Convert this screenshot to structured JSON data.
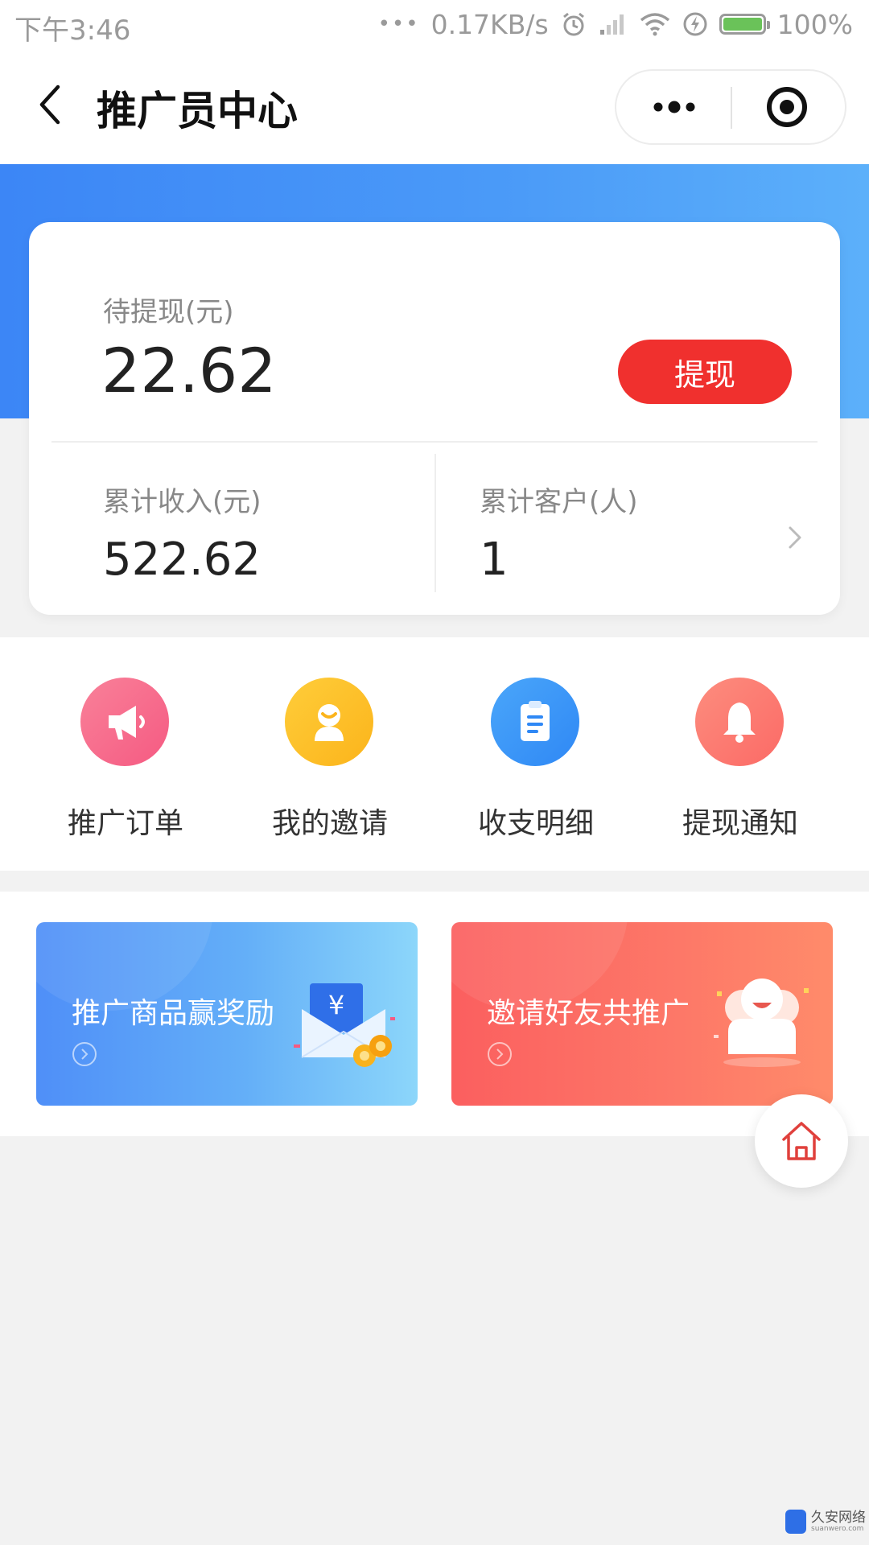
{
  "status_bar": {
    "time": "下午3:46",
    "dots": "•••",
    "network_speed": "0.17KB/s",
    "battery_percent": "100%",
    "icons": [
      "alarm-icon",
      "signal-icon",
      "wifi-icon",
      "charging-icon",
      "battery-icon"
    ]
  },
  "nav": {
    "title": "推广员中心",
    "icons": [
      "back-icon",
      "more-icon",
      "close-icon"
    ]
  },
  "balance": {
    "pending_label": "待提现(元)",
    "pending_amount": "22.62",
    "withdraw_label": "提现",
    "income_label": "累计收入(元)",
    "income_value": "522.62",
    "customers_label": "累计客户(人)",
    "customers_value": "1"
  },
  "menu": {
    "items": [
      {
        "label": "推广订单",
        "icon": "megaphone-icon",
        "color": "#f7668a"
      },
      {
        "label": "我的邀请",
        "icon": "invite-icon",
        "color": "#fdc125"
      },
      {
        "label": "收支明细",
        "icon": "clipboard-icon",
        "color": "#3d98f8"
      },
      {
        "label": "提现通知",
        "icon": "bell-icon",
        "color": "#fd7a70"
      }
    ]
  },
  "banners": [
    {
      "title": "推广商品赢奖励",
      "icon": "red-envelope-icon"
    },
    {
      "title": "邀请好友共推广",
      "icon": "friends-icon"
    }
  ],
  "watermark": {
    "text": "久安网络",
    "sub": "suanwero.com"
  },
  "colors": {
    "brand_blue": "#3c86f6",
    "withdraw_red": "#f0302e",
    "home_icon": "#e0403c"
  }
}
